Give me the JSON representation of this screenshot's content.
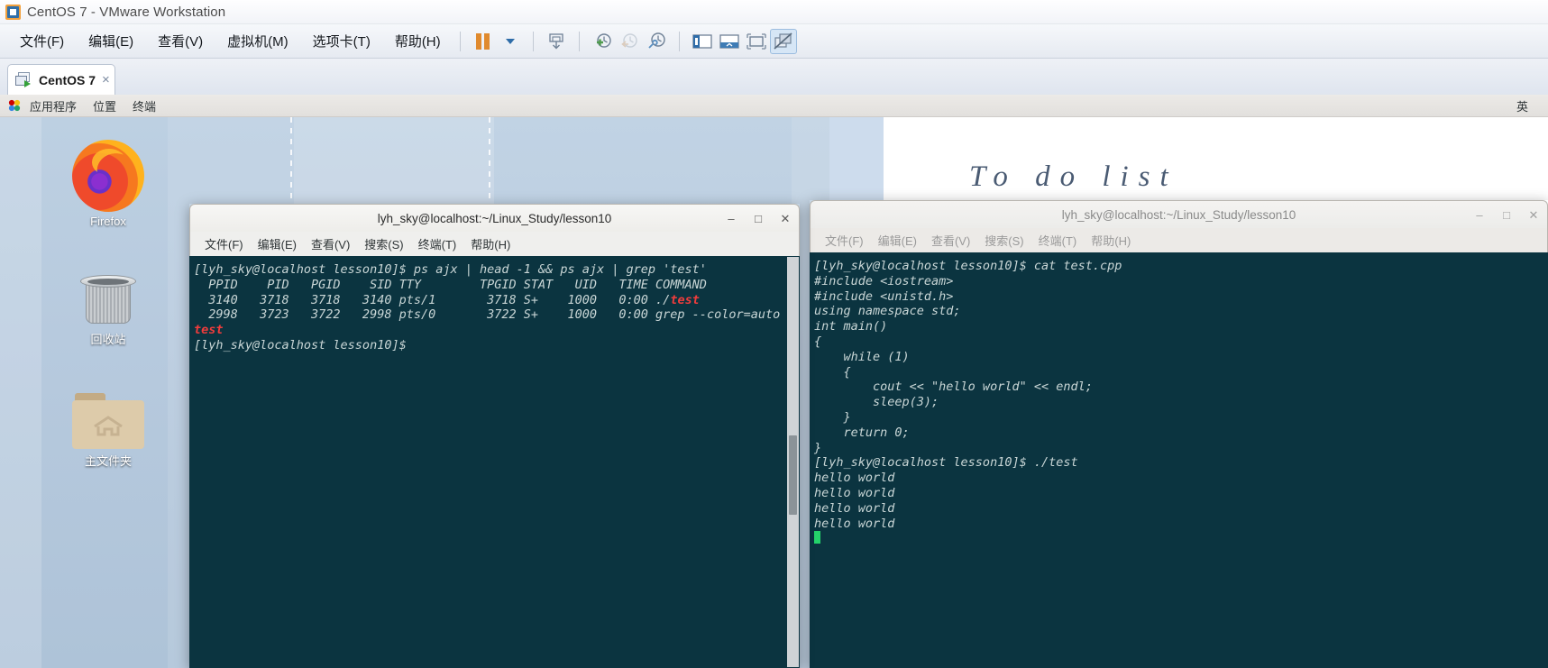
{
  "vmware": {
    "title": "CentOS 7 - VMware Workstation",
    "menu": [
      "文件(F)",
      "编辑(E)",
      "查看(V)",
      "虚拟机(M)",
      "选项卡(T)",
      "帮助(H)"
    ],
    "toolbar_icons": [
      "pause-icon",
      "dropdown-caret-icon",
      "snapshot-take-icon",
      "snapshot-add-icon",
      "snapshot-revert-icon",
      "snapshot-manager-icon",
      "show-sidebar-icon",
      "show-console-icon",
      "fullscreen-icon",
      "unity-icon"
    ],
    "tab": {
      "label": "CentOS 7",
      "close": "×"
    }
  },
  "guest": {
    "panel": {
      "apps": "应用程序",
      "places": "位置",
      "terminal": "终端",
      "input_method": "英"
    },
    "wallpaper_text": "To do list",
    "desktop_icons": [
      {
        "name": "Firefox",
        "icon": "firefox-icon"
      },
      {
        "name": "回收站",
        "icon": "trash-icon"
      },
      {
        "name": "主文件夹",
        "icon": "home-folder-icon"
      }
    ]
  },
  "terminal_left": {
    "title": "lyh_sky@localhost:~/Linux_Study/lesson10",
    "menu": [
      "文件(F)",
      "编辑(E)",
      "查看(V)",
      "搜索(S)",
      "终端(T)",
      "帮助(H)"
    ],
    "window_buttons": {
      "minimize": "‒",
      "maximize": "□",
      "close": "✕"
    },
    "lines": [
      [
        {
          "t": "[lyh_sky@localhost lesson10]$ ps ajx | head -1 && ps ajx | grep 'test'",
          "c": "n"
        }
      ],
      [
        {
          "t": "  PPID    PID   PGID    SID TTY        TPGID STAT   UID   TIME COMMAND",
          "c": "n"
        }
      ],
      [
        {
          "t": "  3140   3718   3718   3140 pts/1       3718 S+    1000   0:00 ./",
          "c": "n"
        },
        {
          "t": "test",
          "c": "r"
        }
      ],
      [
        {
          "t": "  2998   3723   3722   2998 pts/0       3722 S+    1000   0:00 grep --color=auto",
          "c": "n"
        }
      ],
      [
        {
          "t": "test",
          "c": "r"
        }
      ],
      [
        {
          "t": "[lyh_sky@localhost lesson10]$ ",
          "c": "n"
        }
      ]
    ]
  },
  "terminal_right": {
    "title": "lyh_sky@localhost:~/Linux_Study/lesson10",
    "menu": [
      "文件(F)",
      "编辑(E)",
      "查看(V)",
      "搜索(S)",
      "终端(T)",
      "帮助(H)"
    ],
    "window_buttons": {
      "minimize": "‒",
      "maximize": "□",
      "close": "✕"
    },
    "lines": [
      [
        {
          "t": "[lyh_sky@localhost lesson10]$ cat test.cpp",
          "c": "n"
        }
      ],
      [
        {
          "t": "#include <iostream>",
          "c": "n"
        }
      ],
      [
        {
          "t": "#include <unistd.h>",
          "c": "n"
        }
      ],
      [
        {
          "t": "using namespace std;",
          "c": "n"
        }
      ],
      [
        {
          "t": "",
          "c": "n"
        }
      ],
      [
        {
          "t": "int main()",
          "c": "n"
        }
      ],
      [
        {
          "t": "{",
          "c": "n"
        }
      ],
      [
        {
          "t": "    while (1)",
          "c": "n"
        }
      ],
      [
        {
          "t": "    {",
          "c": "n"
        }
      ],
      [
        {
          "t": "        cout << \"hello world\" << endl;",
          "c": "n"
        }
      ],
      [
        {
          "t": "        sleep(3);",
          "c": "n"
        }
      ],
      [
        {
          "t": "    }",
          "c": "n"
        }
      ],
      [
        {
          "t": "    return 0;",
          "c": "n"
        }
      ],
      [
        {
          "t": "}",
          "c": "n"
        }
      ],
      [
        {
          "t": "[lyh_sky@localhost lesson10]$ ./test",
          "c": "n"
        }
      ],
      [
        {
          "t": "hello world",
          "c": "n"
        }
      ],
      [
        {
          "t": "hello world",
          "c": "n"
        }
      ],
      [
        {
          "t": "hello world",
          "c": "n"
        }
      ],
      [
        {
          "t": "hello world",
          "c": "n"
        }
      ],
      [
        {
          "t": "",
          "c": "cursor"
        }
      ]
    ]
  },
  "colors": {
    "terminal_bg": "#0b3440",
    "terminal_fg": "#c9d6d6",
    "terminal_red": "#f03c3c",
    "accent_orange": "#e08a2e",
    "desktop_blue": "#b9cde0"
  }
}
